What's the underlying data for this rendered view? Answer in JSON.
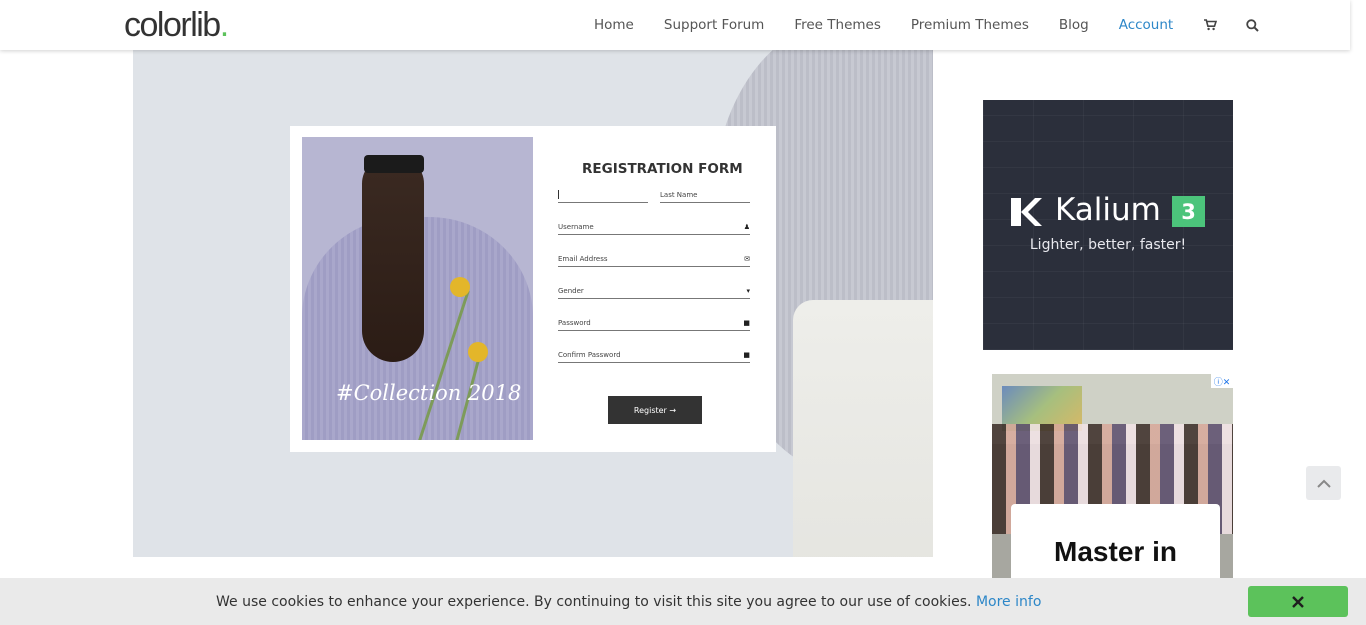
{
  "header": {
    "logo": "colorlib",
    "logo_dot": ".",
    "nav": [
      {
        "label": "Home"
      },
      {
        "label": "Support Forum"
      },
      {
        "label": "Free Themes"
      },
      {
        "label": "Premium Themes"
      },
      {
        "label": "Blog"
      },
      {
        "label": "Account",
        "active": true
      }
    ],
    "icons": [
      "cart-icon",
      "search-icon"
    ],
    "accent_color": "#2d87c8"
  },
  "hero": {
    "form": {
      "title": "REGISTRATION FORM",
      "first_name_value": "",
      "last_name_placeholder": "Last Name",
      "username_placeholder": "Username",
      "email_placeholder": "Email Address",
      "gender_placeholder": "Gender",
      "password_placeholder": "Password",
      "confirm_password_placeholder": "Confirm Password",
      "register_label": "Register →"
    },
    "photo_caption": "#Collection 2018"
  },
  "sidebar": {
    "ad1": {
      "brand": "Kalium",
      "version": "3",
      "tagline": "Lighter, better, faster!",
      "accent_color": "#4cc47b"
    },
    "ad2": {
      "headline": "Master in",
      "adinfo": "ⓘ✕"
    }
  },
  "cookie_bar": {
    "message": "We use cookies to enhance your experience. By continuing to visit this site you agree to our use of cookies.",
    "link": "More info",
    "close_label": "✕",
    "close_color": "#5cc25b"
  }
}
